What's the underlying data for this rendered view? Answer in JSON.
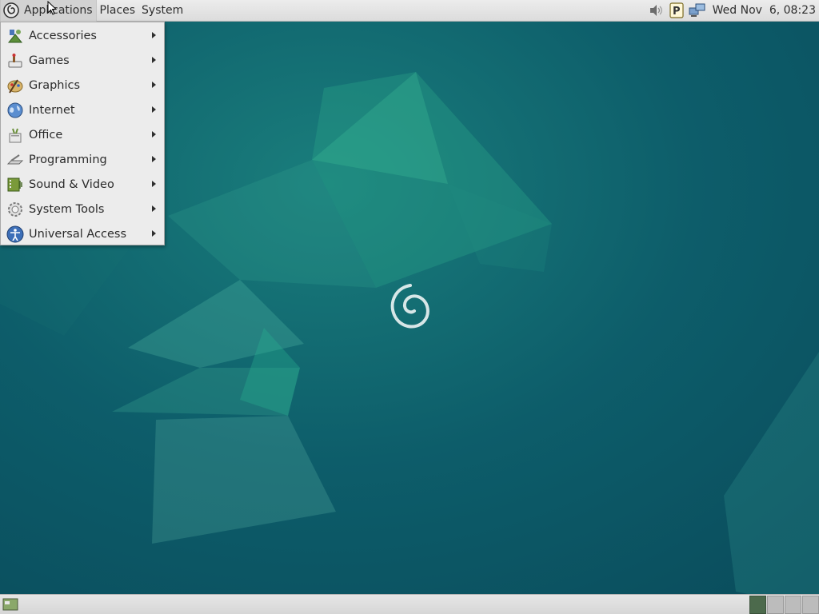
{
  "top_panel": {
    "menus": {
      "applications": "Applications",
      "places": "Places",
      "system": "System"
    },
    "clock": "Wed Nov  6, 08:23",
    "tray_icons": [
      "volume-icon",
      "pidgin-icon",
      "network-icon"
    ]
  },
  "applications_menu": {
    "items": [
      {
        "label": "Accessories",
        "icon": "accessories-icon"
      },
      {
        "label": "Games",
        "icon": "games-icon"
      },
      {
        "label": "Graphics",
        "icon": "graphics-icon"
      },
      {
        "label": "Internet",
        "icon": "internet-icon"
      },
      {
        "label": "Office",
        "icon": "office-icon"
      },
      {
        "label": "Programming",
        "icon": "programming-icon"
      },
      {
        "label": "Sound & Video",
        "icon": "sound-video-icon"
      },
      {
        "label": "System Tools",
        "icon": "system-tools-icon"
      },
      {
        "label": "Universal Access",
        "icon": "universal-access-icon"
      }
    ]
  },
  "bottom_panel": {
    "workspaces": 4,
    "active_workspace": 1
  },
  "colors": {
    "desktop_background": "#0b5564",
    "panel": "#e2e2e2",
    "menu_background": "#ececec"
  }
}
